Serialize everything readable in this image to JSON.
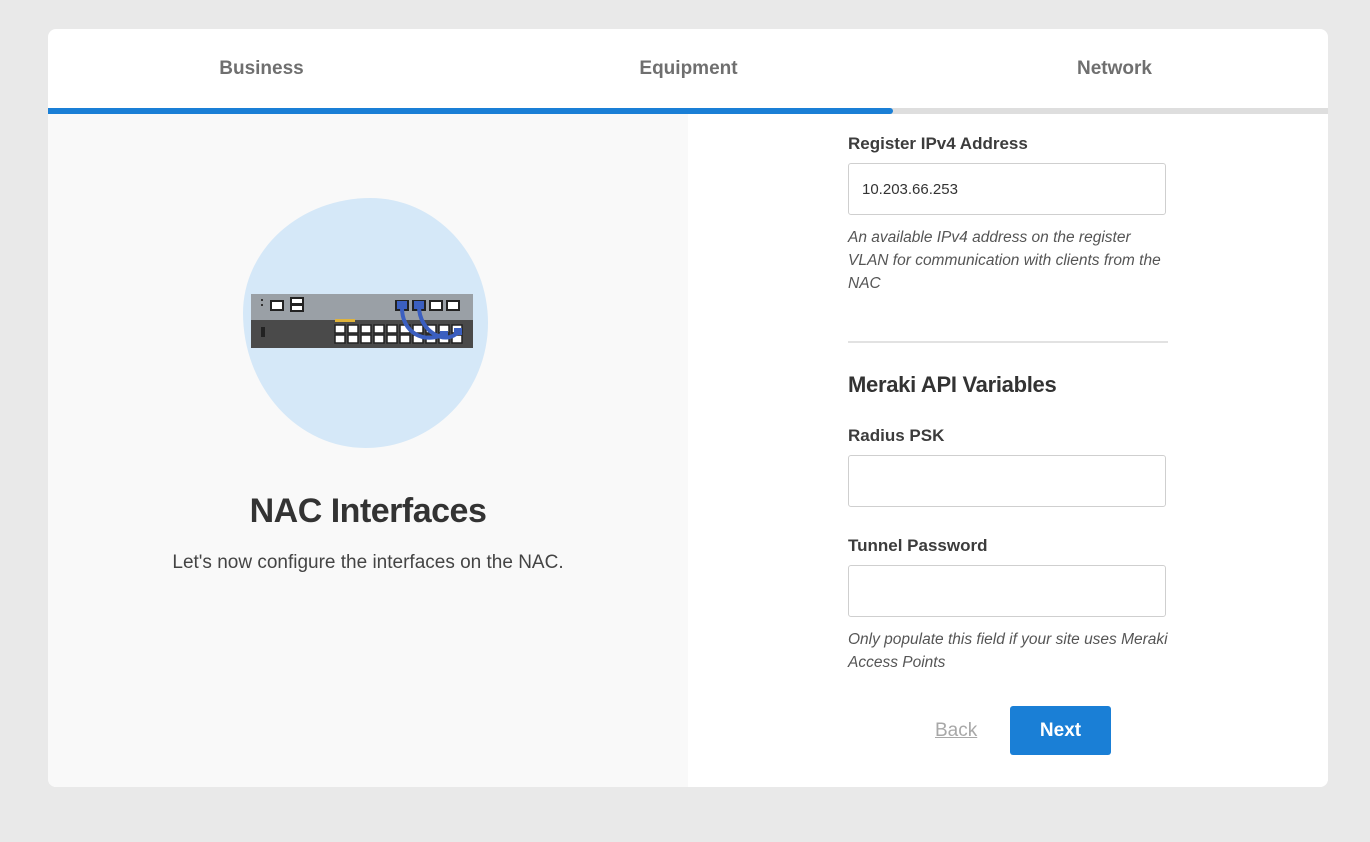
{
  "steps": {
    "tabs": [
      {
        "label": "Business"
      },
      {
        "label": "Equipment"
      },
      {
        "label": "Network"
      }
    ],
    "progress_fraction": 0.66
  },
  "left": {
    "title": "NAC Interfaces",
    "subtitle": "Let's now configure the interfaces on the NAC."
  },
  "form": {
    "register_ip": {
      "label": "Register IPv4 Address",
      "value": "10.203.66.253",
      "help": "An available IPv4 address on the register VLAN for communication with clients from the NAC"
    },
    "section_title": "Meraki API Variables",
    "radius_psk": {
      "label": "Radius PSK",
      "value": ""
    },
    "tunnel_password": {
      "label": "Tunnel Password",
      "value": "",
      "help": "Only populate this field if your site uses Meraki Access Points"
    }
  },
  "actions": {
    "back_label": "Back",
    "next_label": "Next"
  },
  "colors": {
    "accent": "#1a7fd6",
    "blob": "#d5e8f8"
  }
}
